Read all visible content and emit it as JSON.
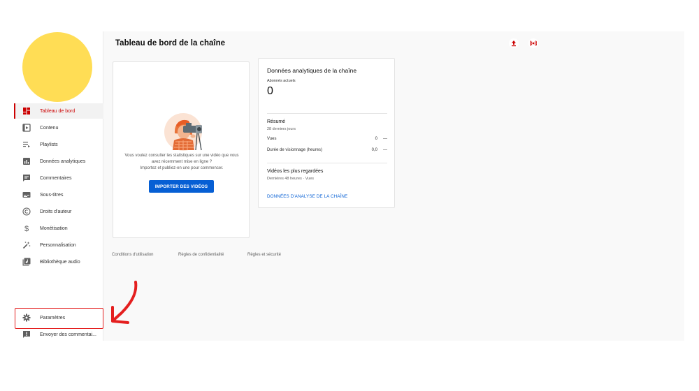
{
  "sidebar": {
    "items": [
      {
        "label": "Tableau de bord",
        "icon": "dashboard-icon",
        "active": true
      },
      {
        "label": "Contenu",
        "icon": "content-icon",
        "active": false
      },
      {
        "label": "Playlists",
        "icon": "playlist-icon",
        "active": false
      },
      {
        "label": "Données analytiques",
        "icon": "analytics-icon",
        "active": false
      },
      {
        "label": "Commentaires",
        "icon": "comments-icon",
        "active": false
      },
      {
        "label": "Sous-titres",
        "icon": "subtitles-icon",
        "active": false
      },
      {
        "label": "Droits d'auteur",
        "icon": "copyright-icon",
        "active": false
      },
      {
        "label": "Monétisation",
        "icon": "dollar-icon",
        "active": false
      },
      {
        "label": "Personnalisation",
        "icon": "magic-wand-icon",
        "active": false
      },
      {
        "label": "Bibliothèque audio",
        "icon": "audio-library-icon",
        "active": false
      }
    ],
    "settings": {
      "label": "Paramètres",
      "icon": "gear-icon"
    },
    "feedback": {
      "label": "Envoyer des commentai...",
      "icon": "feedback-icon"
    }
  },
  "header": {
    "title": "Tableau de bord de la chaîne",
    "icons": [
      "upload-icon",
      "live-icon"
    ]
  },
  "upload_card": {
    "lines": [
      "Vous voulez consulter les statistiques sur une vidéo que vous",
      "avez récemment mise en ligne ?",
      "Importez et publiez-en une pour commencer."
    ],
    "button_label": "IMPORTER DES VIDÉOS"
  },
  "analytics_card": {
    "title": "Données analytiques de la chaîne",
    "subscribers_label": "Abonnés actuels",
    "subscribers_value": "0",
    "summary_title": "Résumé",
    "summary_period": "28 derniers jours",
    "metrics": [
      {
        "label": "Vues",
        "value": "0",
        "trend": "—"
      },
      {
        "label": "Durée de visionnage (heures)",
        "value": "0,0",
        "trend": "—"
      }
    ],
    "top_videos_title": "Vidéos les plus regardées",
    "top_videos_sub": "Dernières 48 heures · Vues",
    "link_label": "DONNÉES D'ANALYSE DE LA CHAÎNE"
  },
  "footer": {
    "links": [
      "Conditions d'utilisation",
      "Règles de confidentialité",
      "Règles et sécurité"
    ]
  },
  "colors": {
    "accent_red": "#cc0000",
    "primary_blue": "#065fd4",
    "highlight_red": "#e41f1f",
    "avatar_yellow": "#ffdd55"
  }
}
